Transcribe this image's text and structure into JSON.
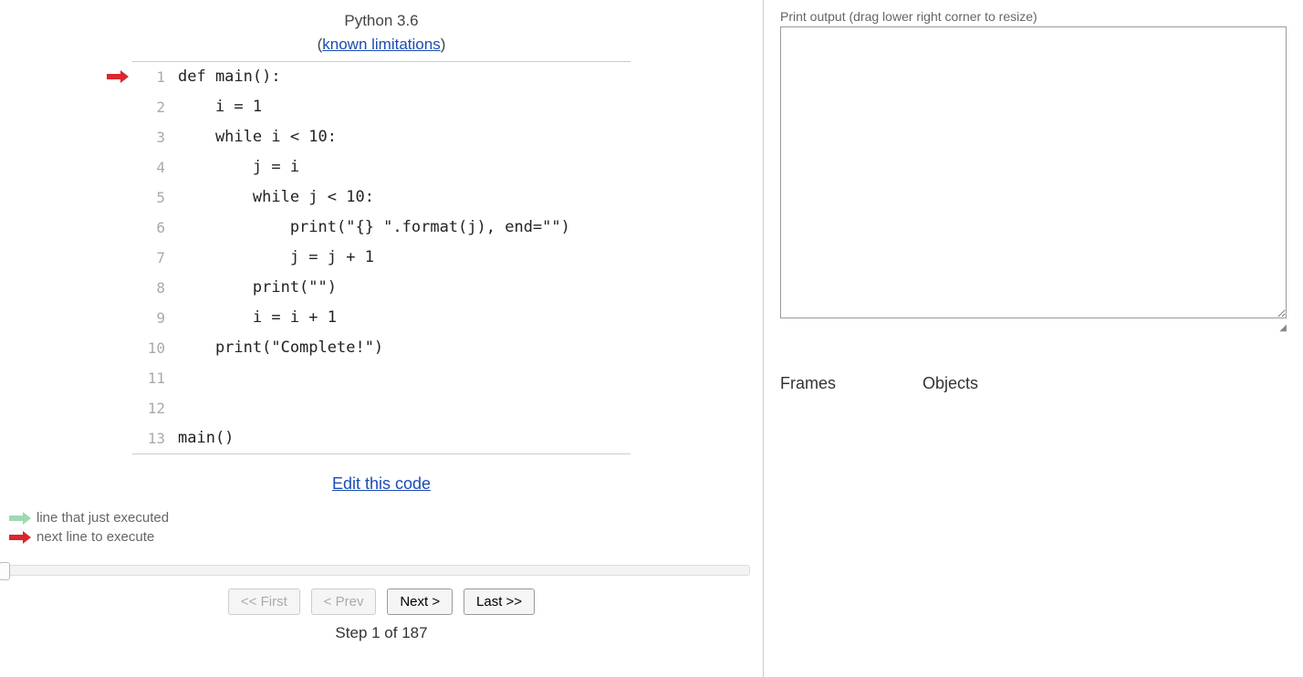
{
  "header": {
    "lang": "Python 3.6",
    "limitations_link": "known limitations"
  },
  "code": {
    "current_line_arrow_at": 1,
    "lines": [
      "def main():",
      "    i = 1",
      "    while i < 10:",
      "        j = i",
      "        while j < 10:",
      "            print(\"{} \".format(j), end=\"\")",
      "            j = j + 1",
      "        print(\"\")",
      "        i = i + 1",
      "    print(\"Complete!\")",
      "",
      "",
      "main()"
    ]
  },
  "links": {
    "edit": "Edit this code"
  },
  "legend": {
    "executed": "line that just executed",
    "next": "next line to execute"
  },
  "controls": {
    "first": "<< First",
    "prev": "< Prev",
    "next": "Next >",
    "last": "Last >>",
    "first_disabled": true,
    "prev_disabled": true,
    "next_disabled": false,
    "last_disabled": false
  },
  "step": {
    "current": 1,
    "total": 187,
    "label": "Step 1 of 187"
  },
  "output": {
    "label": "Print output (drag lower right corner to resize)",
    "value": ""
  },
  "viz": {
    "frames_label": "Frames",
    "objects_label": "Objects"
  },
  "colors": {
    "next_arrow": "#d9272e",
    "executed_arrow": "#a0d8b4",
    "link": "#1a4db3"
  }
}
